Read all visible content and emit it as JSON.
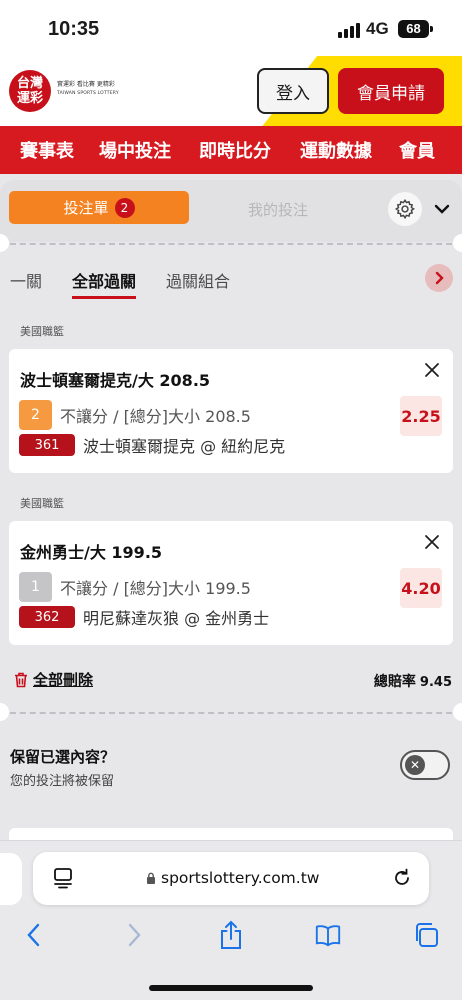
{
  "status_bar": {
    "time": "10:35",
    "network": "4G",
    "battery": "68"
  },
  "header": {
    "logo_text": "台灣\n運彩",
    "logo_subtitle": "實運彩  看比賽  更精彩",
    "logo_english": "TAIWAN SPORTS LOTTERY",
    "login_label": "登入",
    "register_label": "會員申請"
  },
  "main_nav": [
    "賽事表",
    "場中投注",
    "即時比分",
    "運動數據",
    "會員"
  ],
  "slip": {
    "tab_betslip": "投注單",
    "betslip_count": "2",
    "tab_mybets": "我的投注",
    "subtabs": [
      "一關",
      "全部過關",
      "過關組合"
    ],
    "active_subtab": "全部過關",
    "bets": [
      {
        "league": "美國職籃",
        "title": "波士頓塞爾提克/大 208.5",
        "number": "2",
        "market": "不讓分 / [總分]大小 208.5",
        "match_id": "361",
        "match": "波士頓塞爾提克 @ 紐約尼克",
        "odds": "2.25"
      },
      {
        "league": "美國職籃",
        "title": "金州勇士/大 199.5",
        "number": "1",
        "market": "不讓分 / [總分]大小 199.5",
        "match_id": "362",
        "match": "明尼蘇達灰狼 @ 金州勇士",
        "odds": "4.20"
      }
    ],
    "delete_all": "全部刪除",
    "total_odds_label": "總賠率",
    "total_odds_value": "9.45",
    "keep_question": "保留已選內容？",
    "keep_hint": "您的投注將被保留"
  },
  "browser": {
    "url": "sportslottery.com.tw"
  },
  "colors": {
    "brand_red": "#d71920",
    "accent_orange": "#f58220",
    "brand_yellow": "#ffdd00"
  }
}
